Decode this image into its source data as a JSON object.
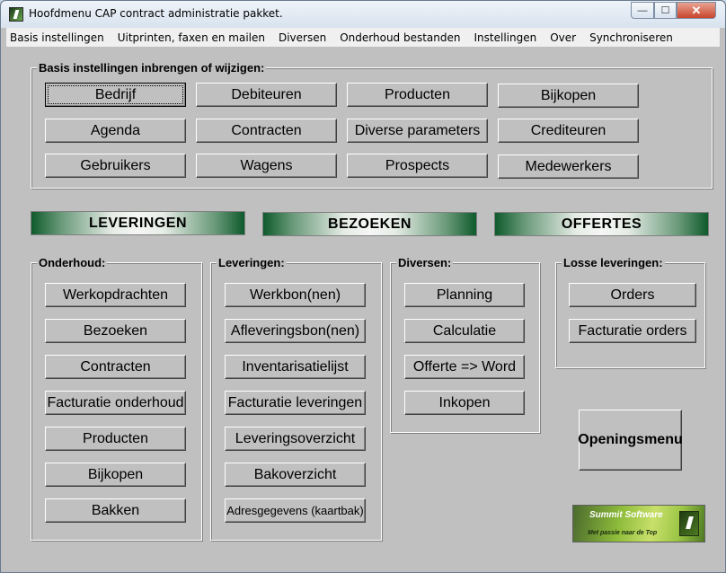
{
  "window": {
    "title": "Hoofdmenu CAP contract administratie pakket.",
    "minimize": "—",
    "maximize": "☐",
    "close": "✕"
  },
  "menu": [
    "Basis instellingen",
    "Uitprinten, faxen en mailen",
    "Diversen",
    "Onderhoud bestanden",
    "Instellingen",
    "Over",
    "Synchroniseren"
  ],
  "basis": {
    "label": "Basis instellingen inbrengen of wijzigen:",
    "buttons": [
      "Bedrijf",
      "Debiteuren",
      "Producten",
      "Bijkopen",
      "Agenda",
      "Contracten",
      "Diverse parameters",
      "Crediteuren",
      "Gebruikers",
      "Wagens",
      "Prospects",
      "Medewerkers"
    ]
  },
  "banners": [
    "LEVERINGEN",
    "BEZOEKEN",
    "OFFERTES"
  ],
  "onderhoud": {
    "label": "Onderhoud:",
    "buttons": [
      "Werkopdrachten",
      "Bezoeken",
      "Contracten",
      "Facturatie onderhoud",
      "Producten",
      "Bijkopen",
      "Bakken"
    ]
  },
  "leveringen": {
    "label": "Leveringen:",
    "buttons": [
      "Werkbon(nen)",
      "Afleveringsbon(nen)",
      "Inventarisatielijst",
      "Facturatie leveringen",
      "Leveringsoverzicht",
      "Bakoverzicht",
      "Adresgegevens (kaartbak)"
    ]
  },
  "diversen": {
    "label": "Diversen:",
    "buttons": [
      "Planning",
      "Calculatie",
      "Offerte => Word",
      "Inkopen"
    ]
  },
  "losse": {
    "label": "Losse leveringen:",
    "buttons": [
      "Orders",
      "Facturatie orders"
    ]
  },
  "openingsmenu": "Openingsmenu",
  "logo": {
    "name": "Summit Software",
    "tagline": "Met passie naar de Top",
    "gradient": [
      "#4a6a2e",
      "#c8e06a"
    ]
  },
  "colors": {
    "face": "#c0c0c0",
    "banner_dark": "#0f5a2c"
  }
}
